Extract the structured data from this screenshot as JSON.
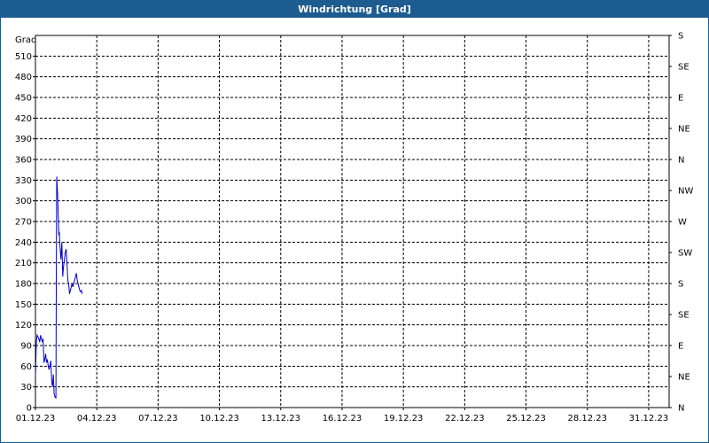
{
  "window": {
    "title": "Windrichtung [Grad]"
  },
  "chart_data": {
    "type": "line",
    "title": "Windrichtung [Grad]",
    "ylabel": "Grad",
    "xlabel": "",
    "ylim": [
      0,
      540
    ],
    "yticks": [
      0,
      30,
      60,
      90,
      120,
      150,
      180,
      210,
      240,
      270,
      300,
      330,
      360,
      390,
      420,
      450,
      480,
      510
    ],
    "x_range_days": [
      0,
      31
    ],
    "x_tick_labels": [
      "01.12.23",
      "04.12.23",
      "07.12.23",
      "10.12.23",
      "13.12.23",
      "16.12.23",
      "19.12.23",
      "22.12.23",
      "25.12.23",
      "28.12.23",
      "31.12.23"
    ],
    "right_axis_labels": [
      "N",
      "NE",
      "E",
      "SE",
      "S",
      "SW",
      "W",
      "NW",
      "N",
      "NE",
      "E",
      "SE",
      "S"
    ],
    "grid": true,
    "series": [
      {
        "color": "#0000c8",
        "x": [
          "01.12.23 00:00",
          "01.12.23 01:00",
          "01.12.23 02:00",
          "01.12.23 04:00",
          "01.12.23 05:00",
          "01.12.23 06:00",
          "01.12.23 07:00",
          "01.12.23 08:00",
          "01.12.23 09:00",
          "01.12.23 10:00",
          "01.12.23 11:00",
          "01.12.23 12:00",
          "01.12.23 13:00",
          "01.12.23 14:00",
          "01.12.23 15:00",
          "01.12.23 16:00",
          "01.12.23 17:00",
          "01.12.23 18:00",
          "01.12.23 19:00",
          "01.12.23 20:00",
          "01.12.23 21:00",
          "01.12.23 22:00",
          "01.12.23 23:00",
          "02.12.23 00:00",
          "02.12.23 00:30",
          "02.12.23 01:00",
          "02.12.23 02:00",
          "02.12.23 03:00",
          "02.12.23 03:30",
          "02.12.23 04:00",
          "02.12.23 05:00",
          "02.12.23 06:00",
          "02.12.23 07:00",
          "02.12.23 08:00",
          "02.12.23 09:00",
          "02.12.23 10:00",
          "02.12.23 11:00",
          "02.12.23 12:00",
          "02.12.23 13:00",
          "02.12.23 14:00",
          "02.12.23 15:00",
          "02.12.23 16:00",
          "02.12.23 17:00",
          "02.12.23 18:00",
          "02.12.23 19:00",
          "02.12.23 20:00",
          "02.12.23 21:00",
          "02.12.23 22:00",
          "02.12.23 23:00",
          "03.12.23 00:00",
          "03.12.23 01:00",
          "03.12.23 02:00",
          "03.12.23 03:00",
          "03.12.23 04:00",
          "03.12.23 05:00",
          "03.12.23 06:00",
          "03.12.23 07:00"
        ],
        "y": [
          45,
          95,
          105,
          100,
          95,
          105,
          100,
          95,
          100,
          65,
          70,
          78,
          65,
          70,
          60,
          55,
          60,
          68,
          40,
          30,
          48,
          20,
          15,
          14,
          175,
          335,
          310,
          270,
          250,
          255,
          230,
          215,
          240,
          190,
          205,
          215,
          225,
          230,
          210,
          185,
          180,
          165,
          170,
          175,
          180,
          175,
          180,
          185,
          190,
          195,
          185,
          180,
          175,
          170,
          168,
          170,
          165
        ]
      }
    ]
  }
}
